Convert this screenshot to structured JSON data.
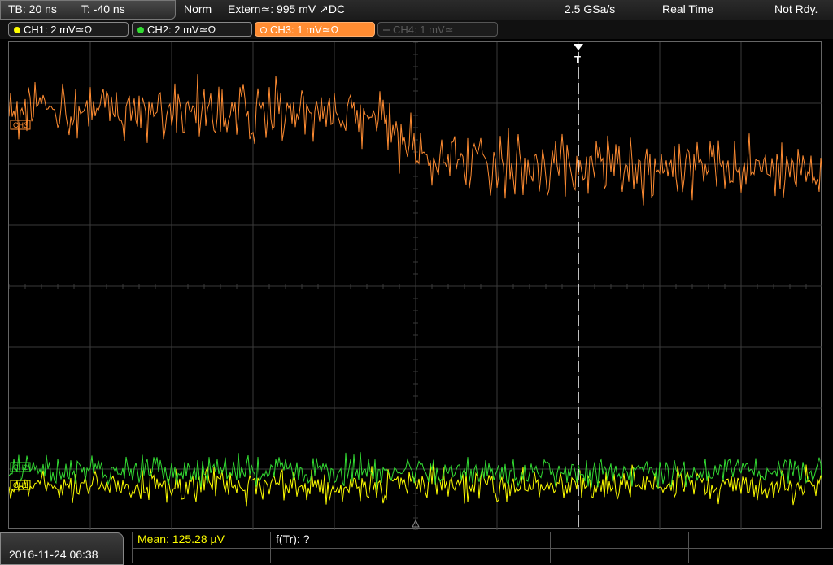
{
  "status": {
    "timebase": "TB: 20 ns",
    "trigger_time": "T: -40 ns",
    "trigger_mode": "Norm",
    "trigger_source": "Extern≃: 995 mV ↗DC",
    "sample_rate": "2.5 GSa/s",
    "acq_mode": "Real Time",
    "ready_state": "Not Rdy."
  },
  "channels": [
    {
      "label": "CH1: 2 mV≃Ω",
      "color": "#ffff00",
      "active": true
    },
    {
      "label": "CH2: 2 mV≃Ω",
      "color": "#33dd33",
      "active": true
    },
    {
      "label": "CH3: 1 mV≃Ω",
      "color": "#ff8c32",
      "active": true,
      "selected": true
    },
    {
      "label": "CH4: 1 mV≃",
      "color": "#555555",
      "active": false
    }
  ],
  "markers": {
    "ch3": "CH3",
    "ch2": "CH2",
    "ch1": "CH1",
    "trigger": "T"
  },
  "measurements": {
    "mean": "Mean: 125.28 µV",
    "f_tr": "f(Tr): ?"
  },
  "datetime": "2016-11-24 06:38",
  "colors": {
    "ch1": "#ffff00",
    "ch2": "#33dd33",
    "ch3": "#ff8c32",
    "grid": "#3a3a3a",
    "trigger_line": "#ffffff"
  }
}
